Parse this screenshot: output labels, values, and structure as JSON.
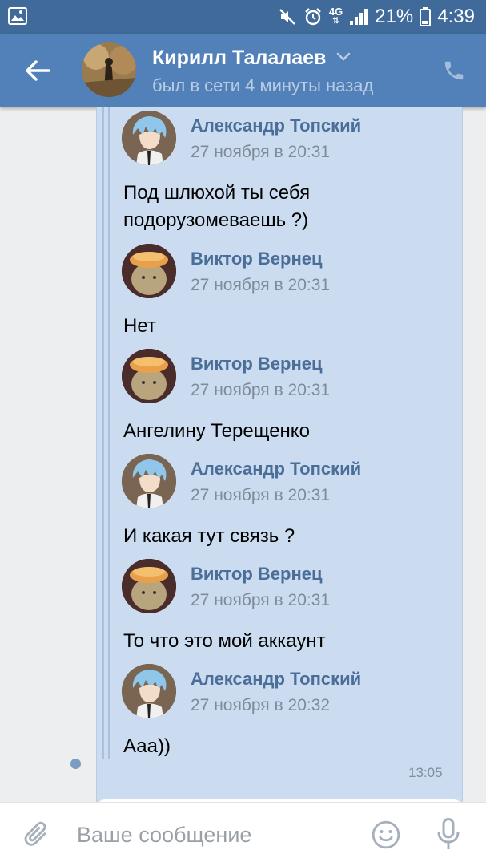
{
  "status_bar": {
    "battery": "21%",
    "time": "4:39",
    "network": "4G",
    "icons": [
      "gallery-icon",
      "mute-icon",
      "alarm-icon",
      "network-4g-icon",
      "signal-icon",
      "battery-icon"
    ]
  },
  "header": {
    "name": "Кирилл Талалаев",
    "status": "был в сети 4 минуты назад",
    "icons": [
      "back-arrow-icon",
      "chevron-down-icon",
      "phone-icon"
    ]
  },
  "messages": [
    {
      "author": "Александр Топский",
      "date": "27 ноября в 20:31",
      "text": "Под шлюхой ты себя подорузомеваешь ?)",
      "avatar": "anime-avatar"
    },
    {
      "author": "Виктор Вернец",
      "date": "27 ноября в 20:31",
      "text": "Нет",
      "avatar": "cat-avatar"
    },
    {
      "author": "Виктор Вернец",
      "date": "27 ноября в 20:31",
      "text": "Ангелину Терещенко",
      "avatar": "cat-avatar"
    },
    {
      "author": "Александр Топский",
      "date": "27 ноября в 20:31",
      "text": "И какая тут связь ?",
      "avatar": "anime-avatar"
    },
    {
      "author": "Виктор Вернец",
      "date": "27 ноября в 20:31",
      "text": "То что это мой аккаунт",
      "avatar": "cat-avatar"
    },
    {
      "author": "Александр Топский",
      "date": "27 ноября в 20:32",
      "text": "Ааа))",
      "avatar": "anime-avatar"
    }
  ],
  "bubble": {
    "time": "13:05"
  },
  "input": {
    "placeholder": "Ваше сообщение",
    "icons": [
      "paperclip-icon",
      "emoji-icon",
      "microphone-icon"
    ]
  },
  "colors": {
    "status_bar": "#3f6a9a",
    "header": "#5181b8",
    "bubble": "#cbdcf0",
    "author": "#4a6e98"
  }
}
